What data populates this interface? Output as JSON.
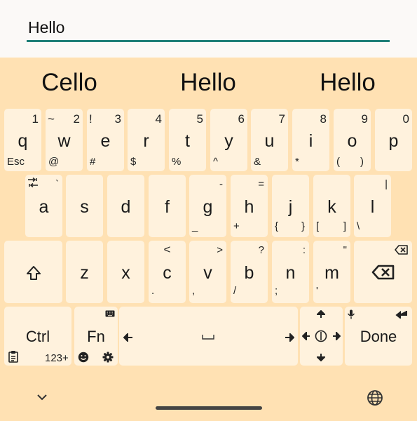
{
  "input": {
    "value": "Hello"
  },
  "suggestions": [
    "Cello",
    "Hello",
    "Hello"
  ],
  "row1": [
    {
      "main": "q",
      "num": "1",
      "sub": "Esc"
    },
    {
      "main": "w",
      "num": "2",
      "tl": "~",
      "sub": "@"
    },
    {
      "main": "e",
      "num": "3",
      "tl": "!",
      "sub": "#"
    },
    {
      "main": "r",
      "num": "4",
      "sub": "$"
    },
    {
      "main": "t",
      "num": "5",
      "sub": "%"
    },
    {
      "main": "y",
      "num": "6",
      "sub": "^"
    },
    {
      "main": "u",
      "num": "7",
      "sub": "&"
    },
    {
      "main": "i",
      "num": "8",
      "sub": "*"
    },
    {
      "main": "o",
      "num": "9",
      "sub": "(",
      "sub2": ")"
    },
    {
      "main": "p",
      "num": "0"
    }
  ],
  "row2": [
    {
      "main": "a",
      "tr": "`"
    },
    {
      "main": "s"
    },
    {
      "main": "d"
    },
    {
      "main": "f"
    },
    {
      "main": "g",
      "tr": "-",
      "bl": "_"
    },
    {
      "main": "h",
      "tr": "=",
      "bl": "+"
    },
    {
      "main": "j",
      "bl": "{",
      "br": "}"
    },
    {
      "main": "k",
      "bl": "[",
      "br": "]"
    },
    {
      "main": "l",
      "tr": "|",
      "bl": "\\"
    }
  ],
  "row3": [
    {
      "main": "z"
    },
    {
      "main": "x"
    },
    {
      "main": "c",
      "tl": "<",
      "bl": "."
    },
    {
      "main": "v",
      "tr": ">",
      "bl": ","
    },
    {
      "main": "b",
      "tr": "?",
      "bl": "/"
    },
    {
      "main": "n",
      "tr": ":",
      "bl": ";"
    },
    {
      "main": "m",
      "tr": "\"",
      "bl": "'"
    }
  ],
  "row4": {
    "ctrl_label": "Ctrl",
    "numeric_label": "123+",
    "fn_label": "Fn",
    "done_label": "Done"
  }
}
